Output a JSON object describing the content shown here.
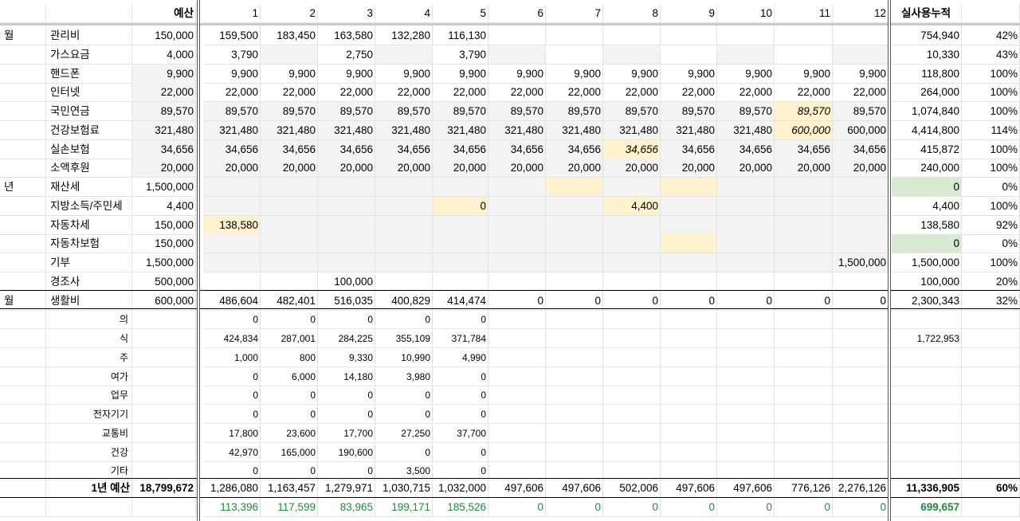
{
  "header": {
    "budget": "예산",
    "months": [
      "1",
      "2",
      "3",
      "4",
      "5",
      "6",
      "7",
      "8",
      "9",
      "10",
      "11",
      "12"
    ],
    "accum": "실사용누적"
  },
  "rows": [
    {
      "kind": "big",
      "group": "월",
      "label": "관리비",
      "budget": "150,000",
      "months": [
        "159,500",
        "183,450",
        "163,580",
        "132,280",
        "116,130",
        "",
        "",
        "",
        "",
        "",
        "",
        ""
      ],
      "total": "754,940",
      "pct": "42%",
      "shade": [
        "",
        "",
        "",
        "",
        "",
        "",
        "",
        "",
        "",
        "",
        "",
        ""
      ]
    },
    {
      "kind": "big",
      "group": "",
      "label": "가스요금",
      "budget": "4,000",
      "months": [
        "3,790",
        "",
        "2,750",
        "",
        "3,790",
        "",
        "",
        "",
        "",
        "",
        "",
        ""
      ],
      "total": "10,330",
      "pct": "43%",
      "shade": [
        "",
        "g",
        "",
        "g",
        "",
        "g",
        "",
        "g",
        "",
        "g",
        "",
        "g"
      ]
    },
    {
      "kind": "big",
      "group": "",
      "label": "핸드폰",
      "budget": "9,900",
      "months": [
        "9,900",
        "9,900",
        "9,900",
        "9,900",
        "9,900",
        "9,900",
        "9,900",
        "9,900",
        "9,900",
        "9,900",
        "9,900",
        "9,900"
      ],
      "total": "118,800",
      "pct": "100%",
      "shade": [
        "",
        "",
        "",
        "",
        "",
        "",
        "",
        "",
        "",
        "",
        "",
        ""
      ],
      "budgetShade": "g"
    },
    {
      "kind": "big",
      "group": "",
      "label": "인터넷",
      "budget": "22,000",
      "months": [
        "22,000",
        "22,000",
        "22,000",
        "22,000",
        "22,000",
        "22,000",
        "22,000",
        "22,000",
        "22,000",
        "22,000",
        "22,000",
        "22,000"
      ],
      "total": "264,000",
      "pct": "100%",
      "shade": [
        "",
        "",
        "",
        "",
        "",
        "",
        "",
        "",
        "",
        "",
        "",
        ""
      ],
      "budgetShade": "g"
    },
    {
      "kind": "big",
      "group": "",
      "label": "국민연금",
      "budget": "89,570",
      "months": [
        "89,570",
        "89,570",
        "89,570",
        "89,570",
        "89,570",
        "89,570",
        "89,570",
        "89,570",
        "89,570",
        "89,570",
        "89,570",
        "89,570"
      ],
      "total": "1,074,840",
      "pct": "100%",
      "shade": [
        "g",
        "g",
        "g",
        "g",
        "g",
        "g",
        "g",
        "g",
        "g",
        "g",
        "y",
        "g"
      ],
      "italic": [
        10
      ],
      "budgetShade": "g"
    },
    {
      "kind": "big",
      "group": "",
      "label": "건강보험료",
      "budget": "321,480",
      "months": [
        "321,480",
        "321,480",
        "321,480",
        "321,480",
        "321,480",
        "321,480",
        "321,480",
        "321,480",
        "321,480",
        "321,480",
        "600,000",
        "600,000"
      ],
      "total": "4,414,800",
      "pct": "114%",
      "shade": [
        "g",
        "g",
        "g",
        "g",
        "g",
        "g",
        "g",
        "g",
        "g",
        "g",
        "y",
        "g"
      ],
      "italic": [
        10
      ],
      "budgetShade": "g"
    },
    {
      "kind": "big",
      "group": "",
      "label": "실손보험",
      "budget": "34,656",
      "months": [
        "34,656",
        "34,656",
        "34,656",
        "34,656",
        "34,656",
        "34,656",
        "34,656",
        "34,656",
        "34,656",
        "34,656",
        "34,656",
        "34,656"
      ],
      "total": "415,872",
      "pct": "100%",
      "shade": [
        "g",
        "g",
        "g",
        "g",
        "g",
        "g",
        "g",
        "y",
        "g",
        "g",
        "g",
        "g"
      ],
      "italic": [
        7
      ],
      "budgetShade": "g"
    },
    {
      "kind": "big",
      "group": "",
      "label": "소액후원",
      "budget": "20,000",
      "months": [
        "20,000",
        "20,000",
        "20,000",
        "20,000",
        "20,000",
        "20,000",
        "20,000",
        "20,000",
        "20,000",
        "20,000",
        "20,000",
        "20,000"
      ],
      "total": "240,000",
      "pct": "100%",
      "shade": [
        "g",
        "g",
        "g",
        "g",
        "g",
        "g",
        "g",
        "g",
        "g",
        "g",
        "g",
        "g"
      ],
      "budgetShade": "g"
    },
    {
      "kind": "big",
      "group": "년",
      "label": "재산세",
      "budget": "1,500,000",
      "months": [
        "",
        "",
        "",
        "",
        "",
        "",
        "",
        "",
        "",
        "",
        "",
        ""
      ],
      "total": "0",
      "pct": "0%",
      "shade": [
        "g",
        "g",
        "g",
        "g",
        "g",
        "g",
        "y",
        "g",
        "y",
        "g",
        "g",
        "g"
      ],
      "totalShade": "green"
    },
    {
      "kind": "big",
      "group": "",
      "label": "지방소득/주민세",
      "budget": "4,400",
      "months": [
        "",
        "",
        "",
        "",
        "0",
        "",
        "",
        "4,400",
        "",
        "",
        "",
        ""
      ],
      "total": "4,400",
      "pct": "100%",
      "shade": [
        "g",
        "g",
        "g",
        "g",
        "y",
        "g",
        "g",
        "y",
        "g",
        "g",
        "g",
        "g"
      ]
    },
    {
      "kind": "big",
      "group": "",
      "label": "자동차세",
      "budget": "150,000",
      "months": [
        "138,580",
        "",
        "",
        "",
        "",
        "",
        "",
        "",
        "",
        "",
        "",
        ""
      ],
      "total": "138,580",
      "pct": "92%",
      "shade": [
        "y",
        "g",
        "g",
        "g",
        "g",
        "g",
        "g",
        "g",
        "g",
        "g",
        "g",
        "g"
      ]
    },
    {
      "kind": "big",
      "group": "",
      "label": "자동차보험",
      "budget": "150,000",
      "months": [
        "",
        "",
        "",
        "",
        "",
        "",
        "",
        "",
        "",
        "",
        "",
        ""
      ],
      "total": "0",
      "pct": "0%",
      "shade": [
        "g",
        "g",
        "g",
        "g",
        "g",
        "g",
        "g",
        "g",
        "y",
        "g",
        "g",
        "g"
      ],
      "totalShade": "green"
    },
    {
      "kind": "big",
      "group": "",
      "label": "기부",
      "budget": "1,500,000",
      "months": [
        "",
        "",
        "",
        "",
        "",
        "",
        "",
        "",
        "",
        "",
        "",
        "1,500,000"
      ],
      "total": "1,500,000",
      "pct": "100%",
      "shade": [
        "g",
        "g",
        "g",
        "g",
        "g",
        "g",
        "g",
        "g",
        "g",
        "g",
        "g",
        "g"
      ]
    },
    {
      "kind": "big",
      "group": "",
      "label": "경조사",
      "budget": "500,000",
      "months": [
        "",
        "",
        "100,000",
        "",
        "",
        "",
        "",
        "",
        "",
        "",
        "",
        ""
      ],
      "total": "100,000",
      "pct": "20%",
      "shade": [
        "",
        "",
        "",
        "",
        "",
        "",
        "",
        "",
        "",
        "",
        "",
        ""
      ]
    },
    {
      "kind": "big",
      "group": "월",
      "label": "생활비",
      "budget": "600,000",
      "months": [
        "486,604",
        "482,401",
        "516,035",
        "400,829",
        "414,474",
        "0",
        "0",
        "0",
        "0",
        "0",
        "0",
        "0"
      ],
      "total": "2,300,343",
      "pct": "32%",
      "shade": [
        "",
        "",
        "",
        "",
        "",
        "",
        "",
        "",
        "",
        "",
        "",
        ""
      ]
    },
    {
      "kind": "sub",
      "label": "의",
      "months": [
        "0",
        "0",
        "0",
        "0",
        "0",
        "",
        "",
        "",
        "",
        "",
        "",
        ""
      ],
      "total": ""
    },
    {
      "kind": "sub",
      "label": "식",
      "months": [
        "424,834",
        "287,001",
        "284,225",
        "355,109",
        "371,784",
        "",
        "",
        "",
        "",
        "",
        "",
        ""
      ],
      "total": "1,722,953"
    },
    {
      "kind": "sub",
      "label": "주",
      "months": [
        "1,000",
        "800",
        "9,330",
        "10,990",
        "4,990",
        "",
        "",
        "",
        "",
        "",
        "",
        ""
      ],
      "total": ""
    },
    {
      "kind": "sub",
      "label": "여가",
      "months": [
        "0",
        "6,000",
        "14,180",
        "3,980",
        "0",
        "",
        "",
        "",
        "",
        "",
        "",
        ""
      ],
      "total": ""
    },
    {
      "kind": "sub",
      "label": "업무",
      "months": [
        "0",
        "0",
        "0",
        "0",
        "0",
        "",
        "",
        "",
        "",
        "",
        "",
        ""
      ],
      "total": ""
    },
    {
      "kind": "sub",
      "label": "전자기기",
      "months": [
        "0",
        "0",
        "0",
        "0",
        "0",
        "",
        "",
        "",
        "",
        "",
        "",
        ""
      ],
      "total": ""
    },
    {
      "kind": "sub",
      "label": "교통비",
      "months": [
        "17,800",
        "23,600",
        "17,700",
        "27,250",
        "37,700",
        "",
        "",
        "",
        "",
        "",
        "",
        ""
      ],
      "total": ""
    },
    {
      "kind": "sub",
      "label": "건강",
      "months": [
        "42,970",
        "165,000",
        "190,600",
        "0",
        "0",
        "",
        "",
        "",
        "",
        "",
        "",
        ""
      ],
      "total": ""
    },
    {
      "kind": "sub",
      "label": "기타",
      "months": [
        "0",
        "0",
        "0",
        "3,500",
        "0",
        "",
        "",
        "",
        "",
        "",
        "",
        ""
      ],
      "total": ""
    }
  ],
  "summary": {
    "label": "1년 예산",
    "budget": "18,799,672",
    "months": [
      "1,286,080",
      "1,163,457",
      "1,279,971",
      "1,030,715",
      "1,032,000",
      "497,606",
      "497,606",
      "502,006",
      "497,606",
      "497,606",
      "776,126",
      "2,276,126"
    ],
    "total": "11,336,905",
    "pct": "60%"
  },
  "diff": {
    "months": [
      "113,396",
      "117,599",
      "83,965",
      "199,171",
      "185,526",
      "0",
      "0",
      "0",
      "0",
      "0",
      "0",
      "0"
    ],
    "total": "699,657"
  }
}
